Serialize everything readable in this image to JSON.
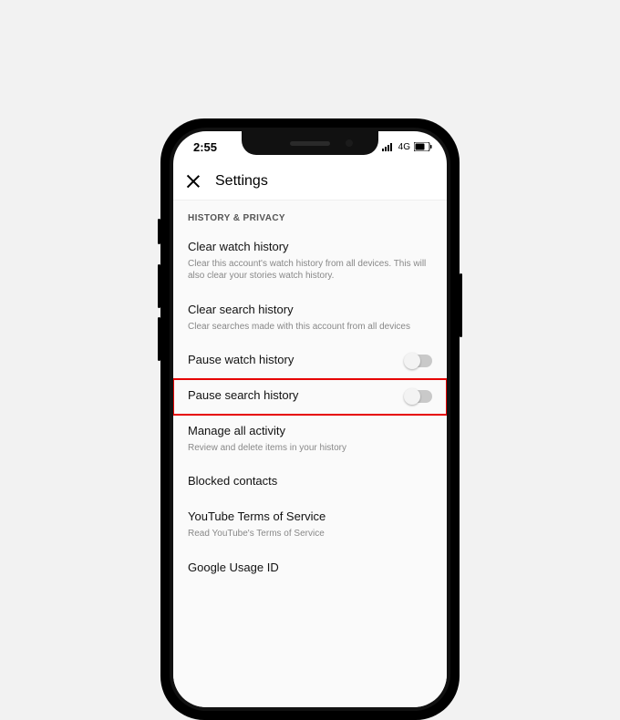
{
  "status": {
    "time": "2:55",
    "network": "4G"
  },
  "nav": {
    "title": "Settings"
  },
  "section": {
    "header": "HISTORY & PRIVACY"
  },
  "rows": {
    "clear_watch": {
      "title": "Clear watch history",
      "subtitle": "Clear this account's watch history from all devices. This will also clear your stories watch history."
    },
    "clear_search": {
      "title": "Clear search history",
      "subtitle": "Clear searches made with this account from all devices"
    },
    "pause_watch": {
      "title": "Pause watch history"
    },
    "pause_search": {
      "title": "Pause search history"
    },
    "manage": {
      "title": "Manage all activity",
      "subtitle": "Review and delete items in your history"
    },
    "blocked": {
      "title": "Blocked contacts"
    },
    "tos": {
      "title": "YouTube Terms of Service",
      "subtitle": "Read YouTube's Terms of Service"
    },
    "usage": {
      "title": "Google Usage ID"
    }
  }
}
